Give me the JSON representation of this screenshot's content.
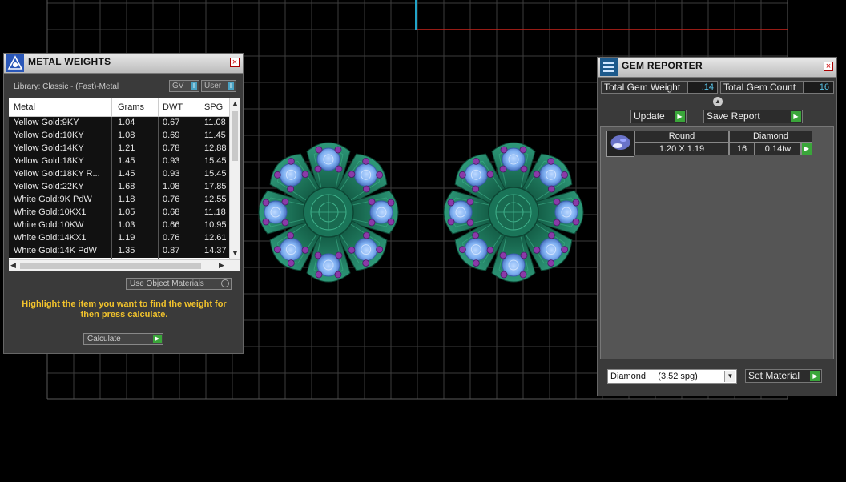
{
  "metal_weights": {
    "title": "METAL WEIGHTS",
    "library_label": "Library: Classic - (Fast)-Metal",
    "toggle_gv": "GV",
    "toggle_user": "User",
    "toggle_indicator": "I",
    "columns": [
      "Metal",
      "Grams",
      "DWT",
      "SPG"
    ],
    "rows": [
      {
        "metal": "Yellow Gold:9KY",
        "grams": "1.04",
        "dwt": "0.67",
        "spg": "11.08"
      },
      {
        "metal": "Yellow Gold:10KY",
        "grams": "1.08",
        "dwt": "0.69",
        "spg": "11.45"
      },
      {
        "metal": "Yellow Gold:14KY",
        "grams": "1.21",
        "dwt": "0.78",
        "spg": "12.88"
      },
      {
        "metal": "Yellow Gold:18KY",
        "grams": "1.45",
        "dwt": "0.93",
        "spg": "15.45"
      },
      {
        "metal": "Yellow Gold:18KY R...",
        "grams": "1.45",
        "dwt": "0.93",
        "spg": "15.45"
      },
      {
        "metal": "Yellow Gold:22KY",
        "grams": "1.68",
        "dwt": "1.08",
        "spg": "17.85"
      },
      {
        "metal": "White Gold:9K PdW",
        "grams": "1.18",
        "dwt": "0.76",
        "spg": "12.55"
      },
      {
        "metal": "White Gold:10KX1",
        "grams": "1.05",
        "dwt": "0.68",
        "spg": "11.18"
      },
      {
        "metal": "White Gold:10KW",
        "grams": "1.03",
        "dwt": "0.66",
        "spg": "10.95"
      },
      {
        "metal": "White Gold:14KX1",
        "grams": "1.19",
        "dwt": "0.76",
        "spg": "12.61"
      },
      {
        "metal": "White Gold:14K PdW",
        "grams": "1.35",
        "dwt": "0.87",
        "spg": "14.37"
      }
    ],
    "use_object_materials_label": "Use Object Materials",
    "hint": "Highlight the item you want to find the weight for then press calculate.",
    "calculate_label": "Calculate"
  },
  "gem_reporter": {
    "title": "GEM REPORTER",
    "total_weight_label": "Total Gem Weight",
    "total_weight_value": ".14",
    "total_count_label": "Total Gem Count",
    "total_count_value": "16",
    "update_label": "Update",
    "save_report_label": "Save Report",
    "gem": {
      "shape": "Round",
      "material": "Diamond",
      "size": "1.20 X 1.19",
      "count": "16",
      "weight": "0.14tw"
    },
    "material_select": "Diamond     (3.52 spg)",
    "set_material_label": "Set Material"
  },
  "colors": {
    "grid": "#3c3c3c",
    "accent_red": "#c8241c",
    "accent_cyan": "#22a4c8",
    "metal": "#1f7f62",
    "gem": "#7fb4ff",
    "prong": "#8a3aa8",
    "hint": "#f2c32c"
  },
  "icons": [
    "metal-weights-app-icon",
    "gem-reporter-app-icon",
    "close-icon",
    "play-arrow-icon",
    "dropdown-arrow-icon",
    "collapse-icon"
  ]
}
